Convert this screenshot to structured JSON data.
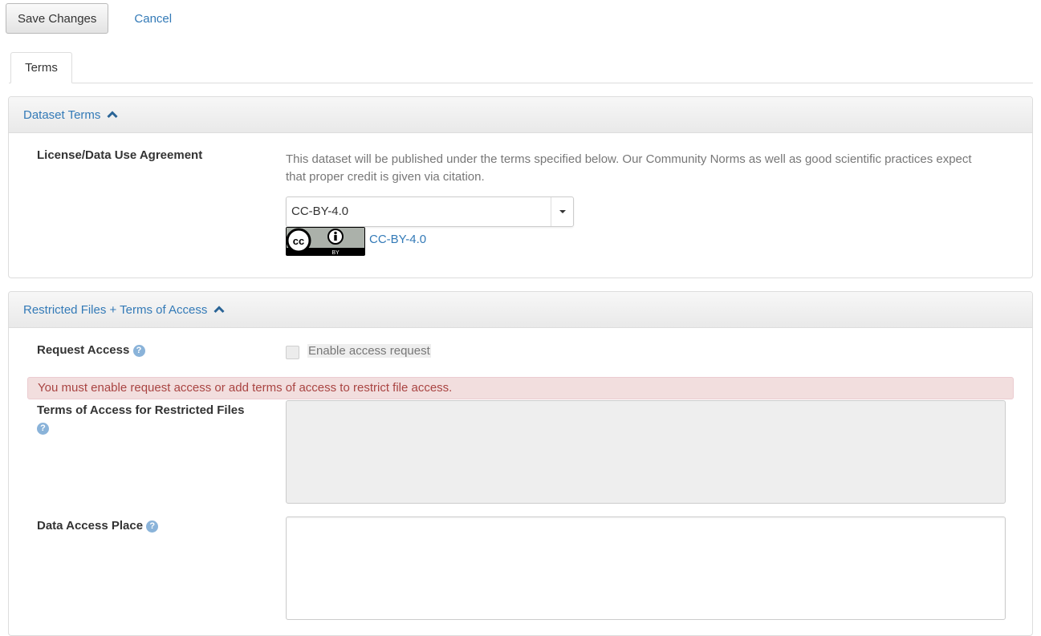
{
  "toolbar": {
    "save_label": "Save Changes",
    "cancel_label": "Cancel"
  },
  "tabs": [
    {
      "label": "Terms",
      "active": true
    }
  ],
  "dataset_terms": {
    "heading": "Dataset Terms",
    "license_label": "License/Data Use Agreement",
    "description": "This dataset will be published under the terms specified below. Our Community Norms as well as good scientific practices expect that proper credit is given via citation.",
    "license_selected": "CC-BY-4.0",
    "license_link": "CC-BY-4.0",
    "badge_text": "BY",
    "badge_icons": [
      "cc-icon",
      "attribution-icon"
    ]
  },
  "restricted": {
    "heading": "Restricted Files + Terms of Access",
    "request_access_label": "Request Access",
    "enable_access_label": "Enable access request",
    "enable_access_checked": false,
    "error_message": "You must enable request access or add terms of access to restrict file access.",
    "terms_of_access_label": "Terms of Access for Restricted Files",
    "terms_of_access_value": "",
    "data_access_place_label": "Data Access Place",
    "data_access_place_value": "",
    "help_glyph": "?"
  },
  "colors": {
    "link": "#337ab7",
    "error_text": "#a94442",
    "error_bg": "#f2dede",
    "help_icon": "#8ab3d9"
  }
}
